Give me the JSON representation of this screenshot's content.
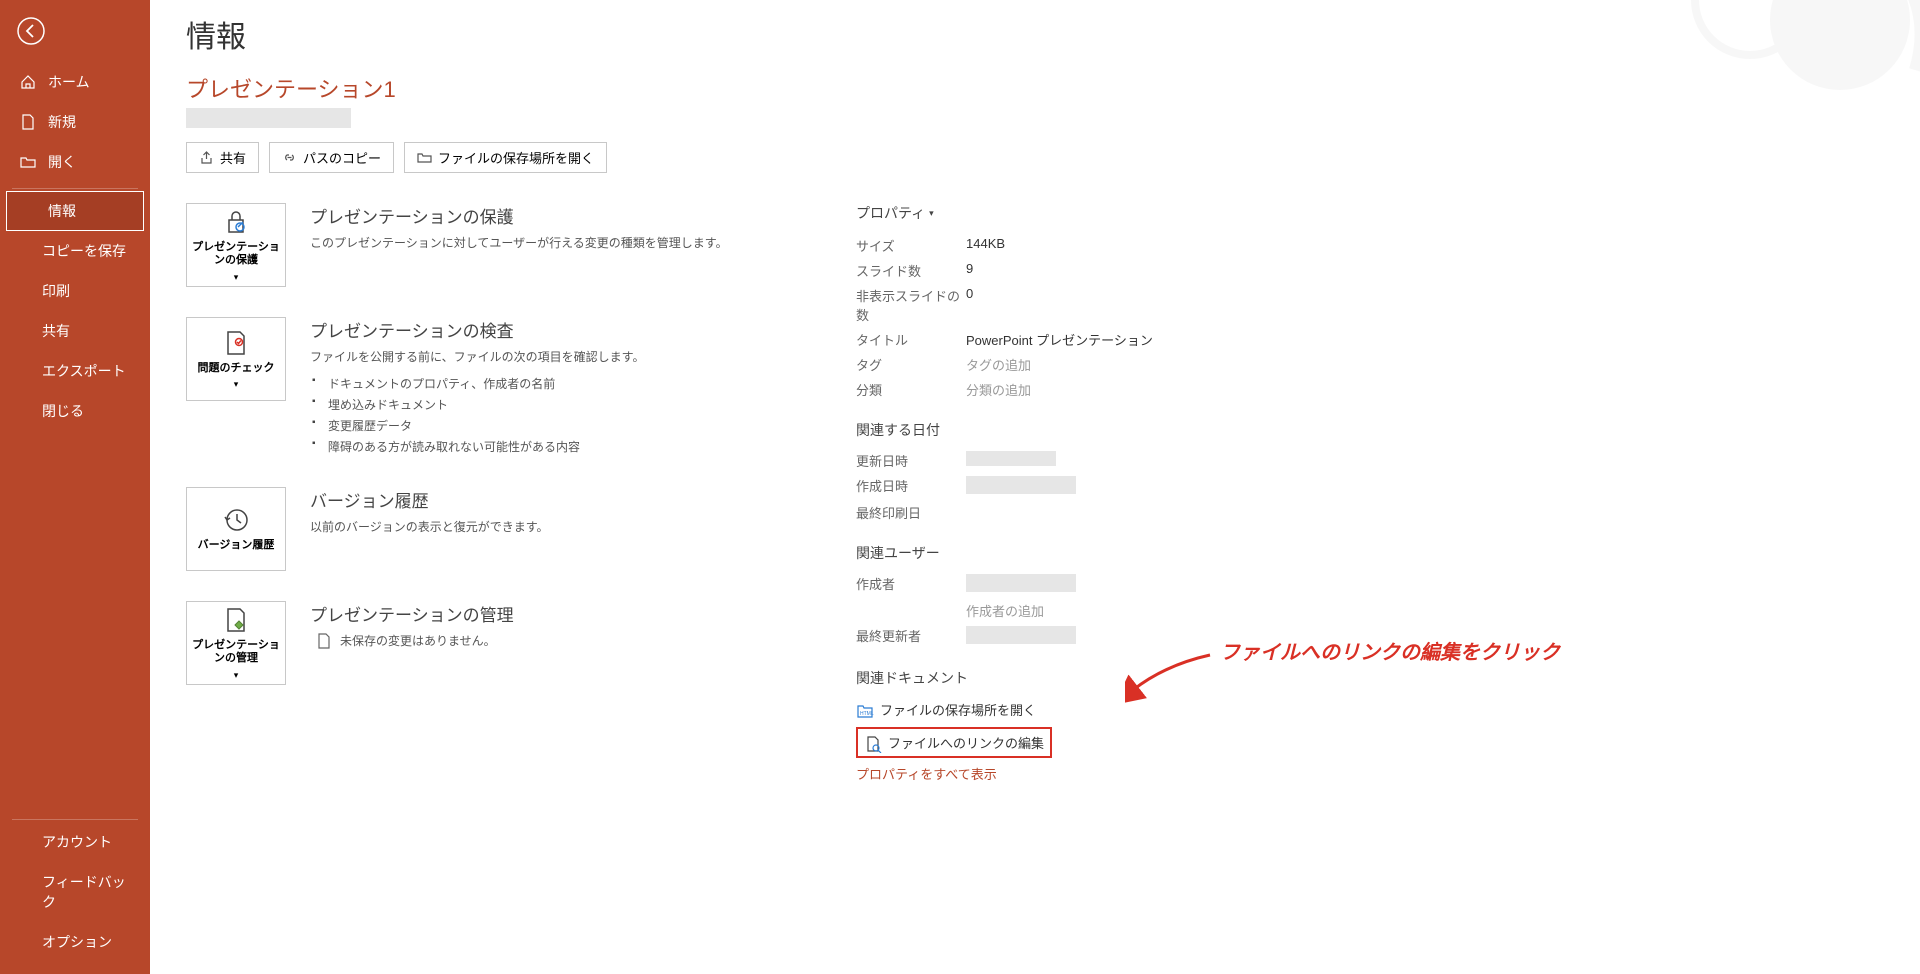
{
  "sidebar": {
    "home": "ホーム",
    "new": "新規",
    "open": "開く",
    "info": "情報",
    "saveAs": "コピーを保存",
    "print": "印刷",
    "share": "共有",
    "export": "エクスポート",
    "close": "閉じる",
    "account": "アカウント",
    "feedback": "フィードバック",
    "options": "オプション"
  },
  "page": {
    "title": "情報",
    "fileTitle": "プレゼンテーション1"
  },
  "actions": {
    "share": "共有",
    "copyPath": "パスのコピー",
    "openLocation": "ファイルの保存場所を開く"
  },
  "cards": {
    "protect": {
      "btnLabel": "プレゼンテーションの保護",
      "title": "プレゼンテーションの保護",
      "desc": "このプレゼンテーションに対してユーザーが行える変更の種類を管理します。"
    },
    "inspect": {
      "btnLabel": "問題のチェック",
      "title": "プレゼンテーションの検査",
      "desc": "ファイルを公開する前に、ファイルの次の項目を確認します。",
      "items": [
        "ドキュメントのプロパティ、作成者の名前",
        "埋め込みドキュメント",
        "変更履歴データ",
        "障碍のある方が読み取れない可能性がある内容"
      ]
    },
    "history": {
      "btnLabel": "バージョン履歴",
      "title": "バージョン履歴",
      "desc": "以前のバージョンの表示と復元ができます。"
    },
    "manage": {
      "btnLabel": "プレゼンテーションの管理",
      "title": "プレゼンテーションの管理",
      "desc": "未保存の変更はありません。"
    }
  },
  "props": {
    "header": "プロパティ",
    "size_l": "サイズ",
    "size_v": "144KB",
    "slides_l": "スライド数",
    "slides_v": "9",
    "hidden_l": "非表示スライドの数",
    "hidden_v": "0",
    "title_l": "タイトル",
    "title_v": "PowerPoint プレゼンテーション",
    "tags_l": "タグ",
    "tags_v": "タグの追加",
    "category_l": "分類",
    "category_v": "分類の追加",
    "dates_h": "関連する日付",
    "modified_l": "更新日時",
    "created_l": "作成日時",
    "printed_l": "最終印刷日",
    "users_h": "関連ユーザー",
    "author_l": "作成者",
    "addAuthor": "作成者の追加",
    "lastMod_l": "最終更新者",
    "docs_h": "関連ドキュメント",
    "openLocation": "ファイルの保存場所を開く",
    "editLinks": "ファイルへのリンクの編集",
    "showAll": "プロパティをすべて表示"
  },
  "annotation": "ファイルへのリンクの編集をクリック"
}
